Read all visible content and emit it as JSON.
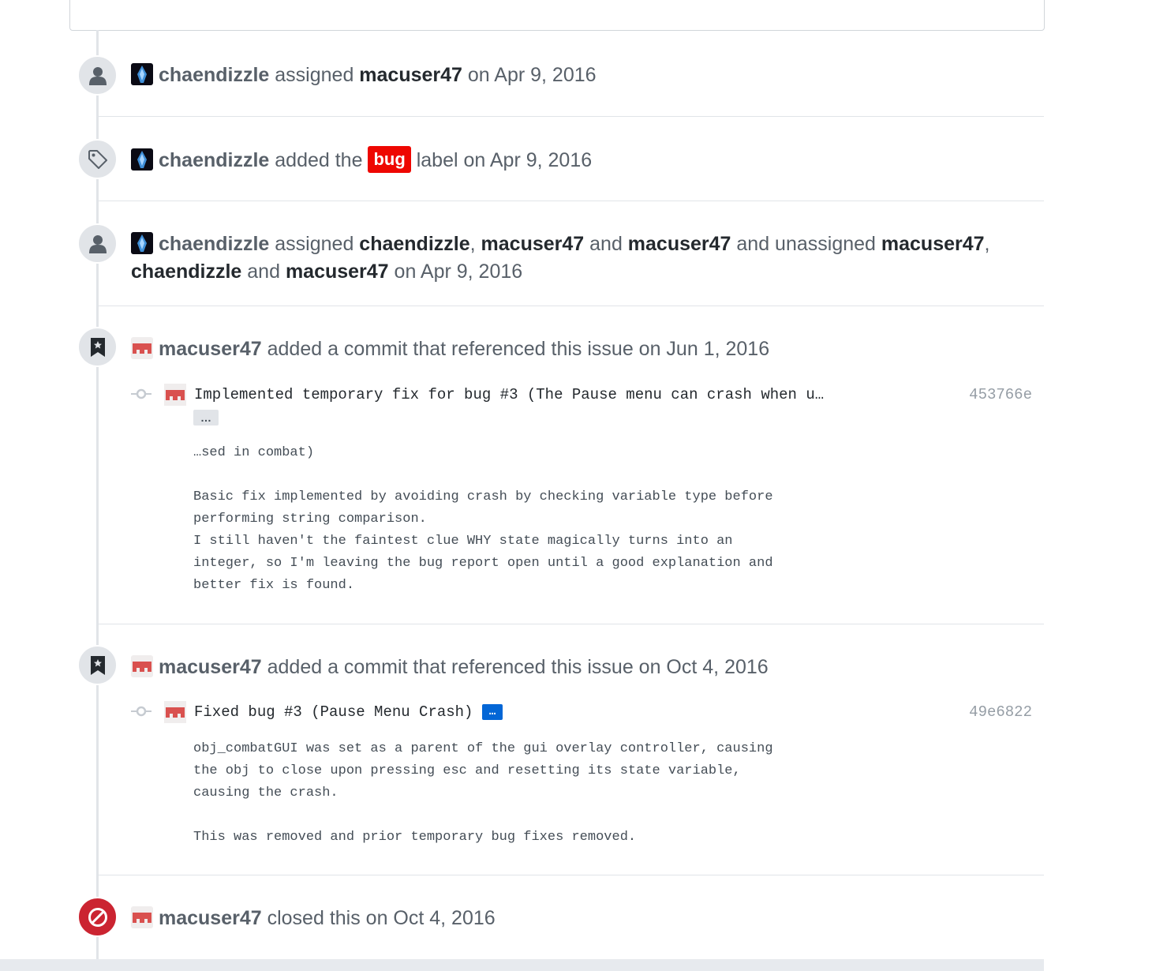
{
  "events": [
    {
      "icon": "person-icon",
      "actor": "chaendizzle",
      "segments": [
        {
          "t": " assigned "
        },
        {
          "b": "macuser47"
        },
        {
          "t": " on Apr 9, 2016"
        }
      ]
    },
    {
      "icon": "tag-icon",
      "actor": "chaendizzle",
      "before_label": " added the ",
      "label": "bug",
      "after_label": " label on Apr 9, 2016"
    },
    {
      "icon": "person-icon",
      "actor": "chaendizzle",
      "line1": [
        {
          "t": " assigned "
        },
        {
          "b": "chaendizzle"
        },
        {
          "t": ", "
        },
        {
          "b": "macuser47"
        },
        {
          "t": " and "
        },
        {
          "b": "macuser47"
        },
        {
          "t": " and unassigned "
        },
        {
          "b": "macuser47"
        },
        {
          "t": ","
        }
      ],
      "line2": [
        {
          "b": "chaendizzle"
        },
        {
          "t": " and "
        },
        {
          "b": "macuser47"
        },
        {
          "t": " on Apr 9, 2016"
        }
      ]
    },
    {
      "icon": "bookmark-icon",
      "actor": "macuser47",
      "text": " added a commit that referenced this issue on Jun 1, 2016",
      "commit": {
        "message": "Implemented temporary fix for bug #3 (The Pause menu can crash when u…",
        "ellipsis": "…",
        "sha": "453766e",
        "body": "…sed in combat)\n\nBasic fix implemented by avoiding crash by checking variable type before\nperforming string comparison.\nI still haven't the faintest clue WHY state magically turns into an\ninteger, so I'm leaving the bug report open until a good explanation and\nbetter fix is found."
      }
    },
    {
      "icon": "bookmark-icon",
      "actor": "macuser47",
      "text": " added a commit that referenced this issue on Oct 4, 2016",
      "commit": {
        "message": "Fixed bug #3 (Pause Menu Crash)",
        "ellipsis": "…",
        "sha": "49e6822",
        "body": "obj_combatGUI was set as a parent of the gui overlay controller, causing\nthe obj to close upon pressing esc and resetting its state variable,\ncausing the crash.\n\nThis was removed and prior temporary bug fixes removed."
      }
    },
    {
      "icon": "circle-slash-icon",
      "actor": "macuser47",
      "text": " closed this on Oct 4, 2016"
    }
  ],
  "colors": {
    "label_bug": "#ee0701",
    "closed_badge": "#cb2431",
    "ellipsis_active": "#0366d6"
  }
}
